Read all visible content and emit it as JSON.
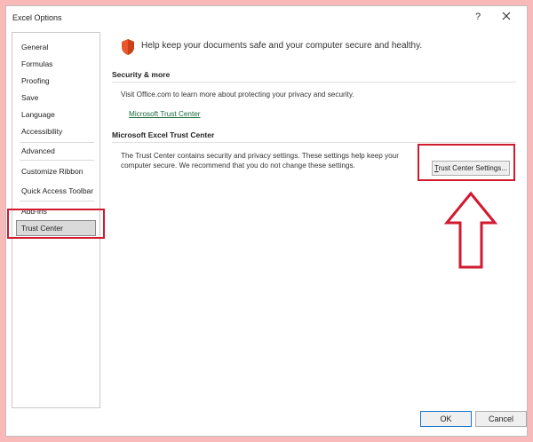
{
  "window": {
    "title": "Excel Options",
    "help": "?",
    "close_label": "×"
  },
  "sidebar": {
    "items": [
      {
        "label": "General"
      },
      {
        "label": "Formulas"
      },
      {
        "label": "Proofing"
      },
      {
        "label": "Save"
      },
      {
        "label": "Language"
      },
      {
        "label": "Accessibility"
      },
      {
        "label": "Advanced"
      },
      {
        "label": "Customize Ribbon"
      },
      {
        "label": "Quick Access Toolbar"
      },
      {
        "label": "Add-ins"
      },
      {
        "label": "Trust Center"
      }
    ],
    "selected": "Trust Center"
  },
  "main": {
    "headline": "Help keep your documents safe and your computer secure and healthy.",
    "security_more": {
      "title": "Security & more",
      "text": "Visit Office.com to learn more about protecting your privacy and security.",
      "link": "Microsoft Trust Center"
    },
    "trust_center": {
      "title": "Microsoft Excel Trust Center",
      "text_line1": "The Trust Center contains security and privacy settings. These settings help keep your",
      "text_line2": "computer secure. We recommend that you do not change these settings.",
      "button_underlined": "T",
      "button_rest": "rust Center Settings..."
    }
  },
  "footer": {
    "ok": "OK",
    "cancel": "Cancel"
  },
  "colors": {
    "highlight": "#d1192f",
    "link": "#1a6b3c",
    "shield": "#e8572b",
    "background": "#f9b9b9"
  }
}
